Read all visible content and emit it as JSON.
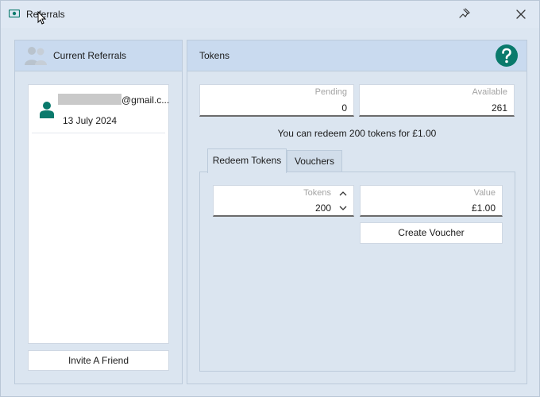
{
  "window": {
    "title": "Referrals",
    "icons": {
      "app": "referral-app-icon",
      "pin": "pin-icon",
      "close": "close-icon"
    }
  },
  "referrals_panel": {
    "title": "Current Referrals",
    "items": [
      {
        "email_suffix": "@gmail.c...",
        "date": "13 July 2024"
      }
    ],
    "invite_label": "Invite A Friend"
  },
  "tokens_panel": {
    "title": "Tokens",
    "pending": {
      "label": "Pending",
      "value": "0"
    },
    "available": {
      "label": "Available",
      "value": "261"
    },
    "redeem_note": "You can redeem 200 tokens for £1.00",
    "tabs": [
      {
        "label": "Redeem Tokens",
        "active": true
      },
      {
        "label": "Vouchers",
        "active": false
      }
    ],
    "redeem": {
      "tokens": {
        "label": "Tokens",
        "value": "200"
      },
      "value": {
        "label": "Value",
        "value": "£1.00"
      },
      "create_label": "Create Voucher"
    }
  },
  "colors": {
    "accent": "#0a7a6c",
    "header_bg": "#c9daef",
    "panel_bg": "#dbe5f0"
  }
}
